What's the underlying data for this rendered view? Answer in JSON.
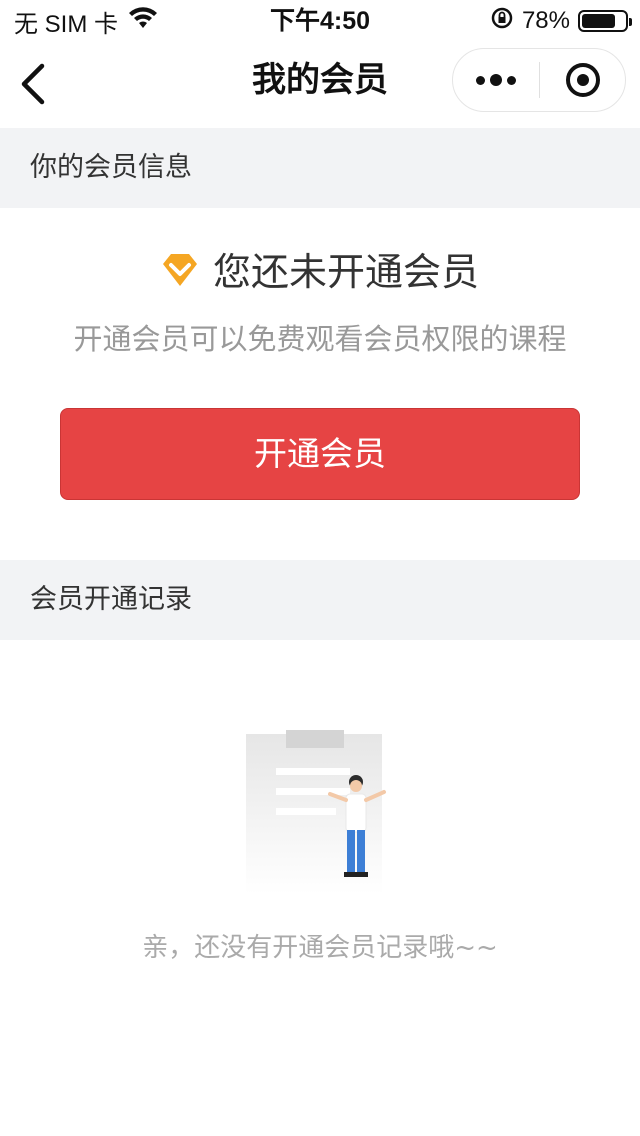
{
  "status_bar": {
    "carrier": "无 SIM 卡",
    "time": "下午4:50",
    "battery_percent": "78%",
    "battery_level": 0.78,
    "icons": [
      "wifi-icon",
      "orientation-lock-icon",
      "battery-icon"
    ]
  },
  "nav": {
    "title": "我的会员",
    "icons": [
      "back-chevron-icon",
      "more-dots-icon",
      "close-target-icon"
    ]
  },
  "member_info": {
    "section_title": "你的会员信息",
    "status_text": "您还未开通会员",
    "description": "开通会员可以免费观看会员权限的课程",
    "button_label": "开通会员",
    "badge_icon": "diamond-icon"
  },
  "records": {
    "section_title": "会员开通记录",
    "empty_text": "亲，还没有开通会员记录哦~~",
    "illustration": "empty-clipboard-person-illustration"
  },
  "colors": {
    "accent_red": "#e64444",
    "badge_orange": "#f5a623",
    "section_bg": "#f2f3f5"
  }
}
